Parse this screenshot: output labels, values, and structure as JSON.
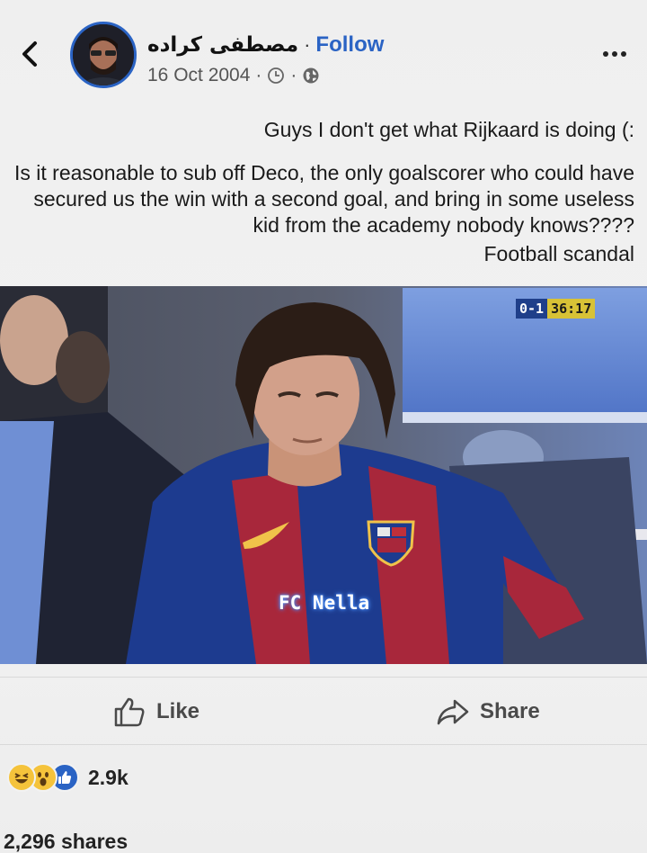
{
  "header": {
    "author_name": "مصطفى كراده",
    "separator": "·",
    "follow_label": "Follow",
    "date": "16 Oct 2004",
    "clock_icon": "clock-icon",
    "globe_icon": "globe-icon"
  },
  "post": {
    "line1": "Guys I don't get what Rijkaard is doing (:",
    "line2": "Is it reasonable to sub off Deco, the only goalscorer who could have secured us the win with a second goal, and bring in some useless kid from the academy nobody knows????",
    "line3": "Football scandal"
  },
  "photo": {
    "score": "0-1",
    "clock": "36:17",
    "overlay_text": "FC Nella"
  },
  "actions": {
    "like_label": "Like",
    "share_label": "Share"
  },
  "stats": {
    "reaction_count": "2.9k",
    "shares": "2,296 shares"
  },
  "colors": {
    "accent": "#2a63c4",
    "barca_blue": "#1d3b8f",
    "barca_red": "#a8273b"
  }
}
